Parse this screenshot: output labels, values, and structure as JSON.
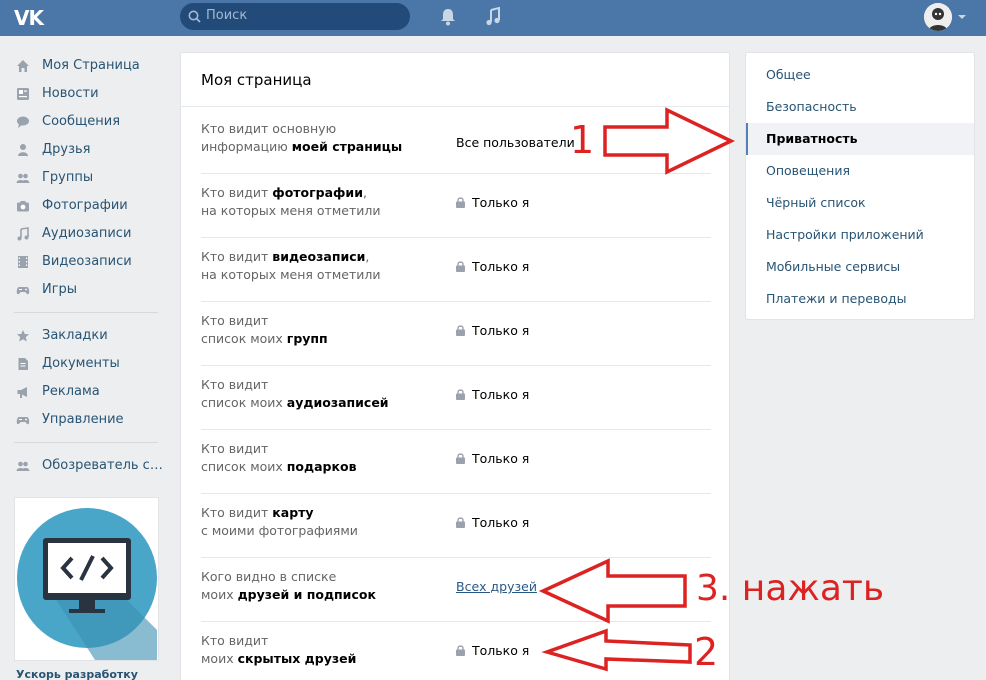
{
  "topbar": {
    "logo": "VK",
    "search_placeholder": "Поиск"
  },
  "sidebar": {
    "items": [
      {
        "label": "Моя Страница",
        "icon": "home-icon"
      },
      {
        "label": "Новости",
        "icon": "news-icon"
      },
      {
        "label": "Сообщения",
        "icon": "messages-icon"
      },
      {
        "label": "Друзья",
        "icon": "friends-icon"
      },
      {
        "label": "Группы",
        "icon": "groups-icon"
      },
      {
        "label": "Фотографии",
        "icon": "camera-icon"
      },
      {
        "label": "Аудиозаписи",
        "icon": "music-icon"
      },
      {
        "label": "Видеозаписи",
        "icon": "video-icon"
      },
      {
        "label": "Игры",
        "icon": "gamepad-icon"
      }
    ],
    "items2": [
      {
        "label": "Закладки",
        "icon": "star-icon"
      },
      {
        "label": "Документы",
        "icon": "document-icon"
      },
      {
        "label": "Реклама",
        "icon": "ads-icon"
      },
      {
        "label": "Управление",
        "icon": "gamepad-icon"
      }
    ],
    "items3": [
      {
        "label": "Обозреватель со…",
        "icon": "community-icon"
      }
    ],
    "promo_caption": "Ускорь разработку"
  },
  "main": {
    "title": "Моя страница",
    "rows": [
      {
        "q1": "Кто видит основную",
        "q2a": "информацию ",
        "q2b": "моей страницы",
        "value": "Все пользователи"
      },
      {
        "q1a": "Кто видит ",
        "q1b": "фотографии",
        "q1c": ",",
        "q2": "на которых меня отметили",
        "value": "Только я"
      },
      {
        "q1a": "Кто видит ",
        "q1b": "видеозаписи",
        "q1c": ",",
        "q2": "на которых меня отметили",
        "value": "Только я"
      },
      {
        "q1": "Кто видит",
        "q2a": "список моих ",
        "q2b": "групп",
        "value": "Только я"
      },
      {
        "q1": "Кто видит",
        "q2a": "список моих ",
        "q2b": "аудиозаписей",
        "value": "Только я"
      },
      {
        "q1": "Кто видит",
        "q2a": "список моих ",
        "q2b": "подарков",
        "value": "Только я"
      },
      {
        "q1a": "Кто видит ",
        "q1b": "карту",
        "q2": "с моими фотографиями",
        "value": "Только я"
      },
      {
        "q1": "Кого видно в списке",
        "q2a": "моих ",
        "q2b": "друзей и подписок",
        "value": "Всех друзей"
      },
      {
        "q1": "Кто видит",
        "q2a": "моих ",
        "q2b": "скрытых друзей",
        "value": "Только я"
      }
    ]
  },
  "right_menu": {
    "items": [
      "Общее",
      "Безопасность",
      "Приватность",
      "Оповещения",
      "Чёрный список",
      "Настройки приложений",
      "Мобильные сервисы",
      "Платежи и переводы"
    ],
    "active": "Приватность"
  },
  "annotations": {
    "label1": "1",
    "label2": "2",
    "label3": "3. нажать"
  },
  "colors": {
    "topbar": "#4a76a8",
    "link": "#285473",
    "annotation": "#dd2222"
  }
}
